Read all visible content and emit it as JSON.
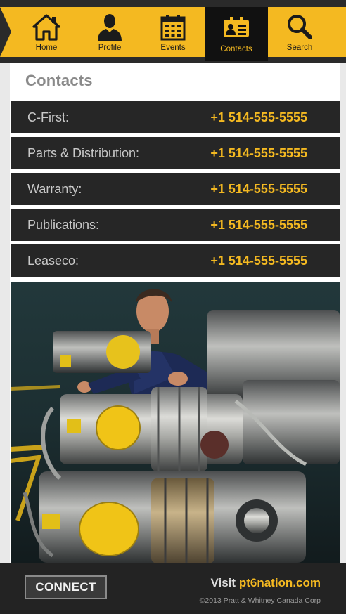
{
  "nav": {
    "items": [
      {
        "label": "Home",
        "icon": "home-icon",
        "active": false
      },
      {
        "label": "Profile",
        "icon": "person-icon",
        "active": false
      },
      {
        "label": "Events",
        "icon": "calendar-icon",
        "active": false
      },
      {
        "label": "Contacts",
        "icon": "contact-card-icon",
        "active": true
      },
      {
        "label": "Search",
        "icon": "search-icon",
        "active": false
      }
    ]
  },
  "page": {
    "title": "Contacts"
  },
  "contacts": [
    {
      "name": "C-First:",
      "phone": "+1 514-555-5555"
    },
    {
      "name": "Parts & Distribution:",
      "phone": "+1 514-555-5555"
    },
    {
      "name": "Warranty:",
      "phone": "+1 514-555-5555"
    },
    {
      "name": "Publications:",
      "phone": "+1 514-555-5555"
    },
    {
      "name": "Leaseco:",
      "phone": "+1 514-555-5555"
    }
  ],
  "footer": {
    "connect_label": "CONNECT",
    "visit_prefix": "Visit",
    "visit_site": "pt6nation.com",
    "copyright": "©2013 Pratt & Whitney Canada Corp"
  },
  "colors": {
    "accent": "#f4b921",
    "dark": "#262626",
    "panel": "#ffffff"
  }
}
